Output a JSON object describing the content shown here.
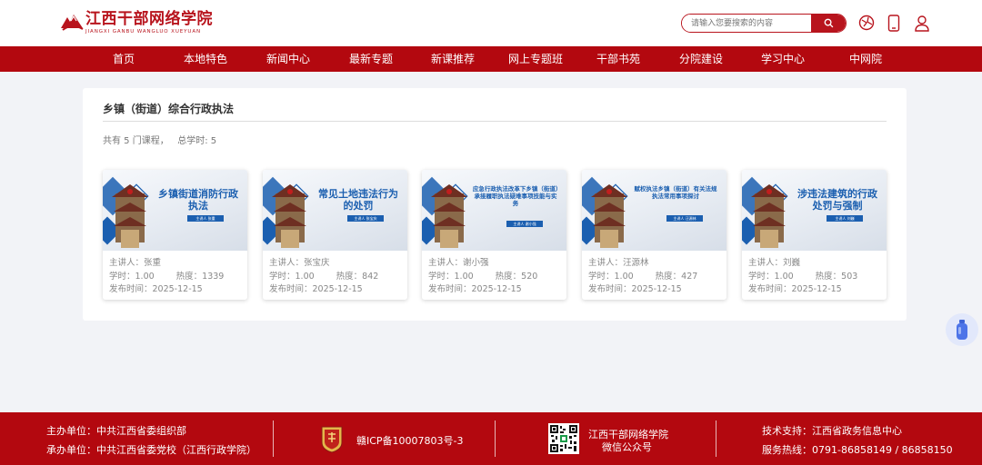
{
  "header": {
    "logo_cn": "江西干部网络学院",
    "logo_en": "JIANGXI GANBU WANGLUO XUEYUAN",
    "search_placeholder": "请输入您要搜索的内容"
  },
  "nav": [
    "首页",
    "本地特色",
    "新闻中心",
    "最新专题",
    "新课推荐",
    "网上专题班",
    "干部书苑",
    "分院建设",
    "学习中心",
    "中网院"
  ],
  "panel": {
    "title": "乡镇（街道）综合行政执法",
    "summary": "共有 5 门课程，   总学时: 5"
  },
  "courses": [
    {
      "thumb_title": "乡镇街道消防行政执法",
      "thumb_sub": "主讲人  张重",
      "speaker": "主讲人：张重",
      "hours": "学时：1.00",
      "heat": "热度：1339",
      "date": "发布时间：2025-12-15"
    },
    {
      "thumb_title": "常见土地违法行为的处罚",
      "thumb_sub": "主讲人  张宝庆",
      "speaker": "主讲人：张宝庆",
      "hours": "学时：1.00",
      "heat": "热度：842",
      "date": "发布时间：2025-12-15"
    },
    {
      "thumb_title": "应急行政执法改革下乡镇（街道）承接履职执法疑难事项技能与实务",
      "thumb_sub": "主讲人  谢小强",
      "speaker": "主讲人：谢小强",
      "hours": "学时：1.00",
      "heat": "热度：520",
      "date": "发布时间：2025-12-15"
    },
    {
      "thumb_title": "赋权执法乡镇（街道）有关法规执法常用事项探讨",
      "thumb_sub": "主讲人  汪源林",
      "speaker": "主讲人：汪源林",
      "hours": "学时：1.00",
      "heat": "热度：427",
      "date": "发布时间：2025-12-15"
    },
    {
      "thumb_title": "涉违法建筑的行政处罚与强制",
      "thumb_sub": "主讲人  刘巍",
      "speaker": "主讲人：刘巍",
      "hours": "学时：1.00",
      "heat": "热度：503",
      "date": "发布时间：2025-12-15"
    }
  ],
  "footer": {
    "host": "主办单位：中共江西省委组织部",
    "organizer": "承办单位：中共江西省委党校（江西行政学院）",
    "icp": "赣ICP备10007803号-3",
    "wechat_name": "江西干部网络学院",
    "wechat_label": "微信公众号",
    "tech": "技术支持：江西省政务信息中心",
    "hotline": "服务热线：0791-86858149 / 86858150"
  },
  "colors": {
    "brand_red": "#b3080f",
    "accent_blue": "#1b5fb0"
  }
}
